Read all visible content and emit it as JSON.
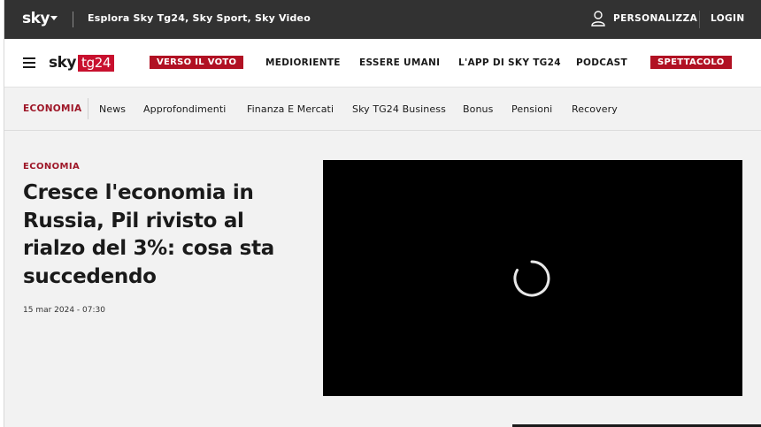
{
  "topbar": {
    "logo": "sky",
    "explore": "Esplora Sky Tg24, Sky Sport, Sky Video",
    "personalize": "PERSONALIZZA",
    "login": "LOGIN"
  },
  "brand": {
    "sky": "sky",
    "tg": "tg24"
  },
  "nav": {
    "items": [
      {
        "label": "VERSO IL VOTO",
        "highlight": true
      },
      {
        "label": "MEDIORIENTE",
        "highlight": false
      },
      {
        "label": "ESSERE UMANI",
        "highlight": false
      },
      {
        "label": "L'APP DI SKY TG24",
        "highlight": false
      },
      {
        "label": "PODCAST",
        "highlight": false
      },
      {
        "label": "SPETTACOLO",
        "highlight": true
      }
    ]
  },
  "subnav": {
    "active": "ECONOMIA",
    "items": [
      "News",
      "Approfondimenti",
      "Finanza E Mercati",
      "Sky TG24 Business",
      "Bonus",
      "Pensioni",
      "Recovery"
    ]
  },
  "article": {
    "kicker": "ECONOMIA",
    "headline": "Cresce l'economia in Russia, Pil rivisto al rialzo del 3%: cosa sta succedendo",
    "date": "15 mar 2024 - 07:30"
  },
  "video": {
    "state_icon": "loading-spinner-icon"
  },
  "colors": {
    "accent": "#b11123",
    "topbar": "#323232",
    "kicker": "#9e1728"
  }
}
